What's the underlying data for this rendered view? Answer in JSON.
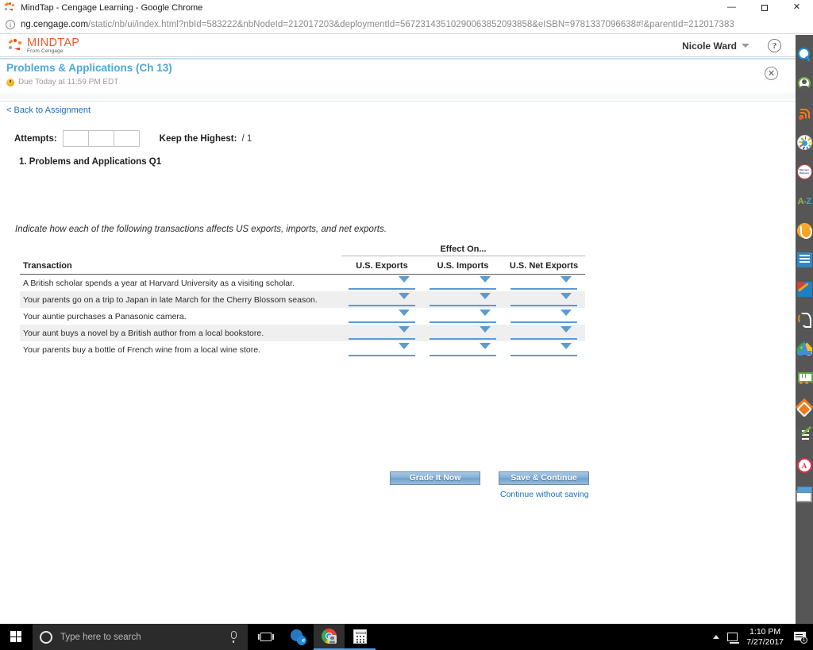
{
  "window": {
    "title": "MindTap - Cengage Learning - Google Chrome",
    "favicon": "mindtap-favicon",
    "controls": {
      "minimize": "—",
      "maximize": "❐",
      "close": "✕"
    }
  },
  "omnibox": {
    "info_icon": "i",
    "host": "ng.cengage.com",
    "path": "/static/nb/ui/index.html?nbId=583222&nbNodeId=212017203&deploymentId=56723143510290063852093858&eISBN=9781337096638#!&parentId=212017383"
  },
  "mindtap_header": {
    "logo_primary": "MINDTAP",
    "logo_secondary": "From Cengage",
    "user_name": "Nicole Ward",
    "help_label": "?"
  },
  "assignment": {
    "title": "Problems & Applications (Ch 13)",
    "due_text": "Due Today at 11:59 PM EDT",
    "close_label": "✕"
  },
  "content": {
    "back_link": "< Back to Assignment",
    "attempts_label": "Attempts:",
    "attempt_values": [
      "",
      "",
      ""
    ],
    "keep_highest_label": "Keep the Highest:",
    "keep_highest_value": "/ 1",
    "question_title": "1. Problems and Applications Q1",
    "prompt": "Indicate how each of the following transactions affects US exports, imports, and net exports."
  },
  "table": {
    "group_header": "Effect On...",
    "col_transaction": "Transaction",
    "columns": [
      "U.S. Exports",
      "U.S. Imports",
      "U.S. Net Exports"
    ],
    "rows": [
      {
        "transaction": "A British scholar spends a year at Harvard University as a visiting scholar.",
        "exports": "",
        "imports": "",
        "net_exports": ""
      },
      {
        "transaction": "Your parents go on a trip to Japan in late March for the Cherry Blossom season.",
        "exports": "",
        "imports": "",
        "net_exports": ""
      },
      {
        "transaction": "Your auntie purchases a Panasonic camera.",
        "exports": "",
        "imports": "",
        "net_exports": ""
      },
      {
        "transaction": "Your aunt buys a novel by a British author from a local bookstore.",
        "exports": "",
        "imports": "",
        "net_exports": ""
      },
      {
        "transaction": "Your parents buy a bottle of French wine from a local wine store.",
        "exports": "",
        "imports": "",
        "net_exports": ""
      }
    ]
  },
  "actions": {
    "grade_it_now": "Grade It Now",
    "save_and_continue": "Save & Continue",
    "continue_without_saving": "Continue without saving"
  },
  "tool_rail": {
    "items": [
      {
        "name": "search-icon",
        "label": "Search"
      },
      {
        "name": "profile-icon",
        "label": "Profile"
      },
      {
        "name": "rss-feed-icon",
        "label": "Feed"
      },
      {
        "name": "color-wheel-icon",
        "label": "Color Wheel"
      },
      {
        "name": "merriam-webster-icon",
        "label": "Merriam Webster"
      },
      {
        "name": "a-z-dictionary-icon",
        "label": "A-Z"
      },
      {
        "name": "six-swirl-icon",
        "label": "Cengage Tool"
      },
      {
        "name": "reader-book-icon",
        "label": "Reader"
      },
      {
        "name": "notebook-pencil-icon",
        "label": "Notes"
      },
      {
        "name": "read-aloud-icon",
        "label": "Read Aloud"
      },
      {
        "name": "google-drive-icon",
        "label": "Google Drive"
      },
      {
        "name": "shopping-cart-icon",
        "label": "Store"
      },
      {
        "name": "diamond-gear-icon",
        "label": "Tools"
      },
      {
        "name": "quiz-pencil-icon",
        "label": "Practice"
      },
      {
        "name": "a-plus-grade-icon",
        "label": "Grades"
      },
      {
        "name": "flashcards-icon",
        "label": "Flashcards"
      }
    ],
    "merriam_text": "Merriam Webster"
  },
  "taskbar": {
    "search_placeholder": "Type here to search",
    "apps": [
      {
        "name": "taskbar-app-edge",
        "label": "Microsoft Edge"
      },
      {
        "name": "taskbar-app-chrome",
        "label": "Google Chrome"
      },
      {
        "name": "taskbar-app-calculator",
        "label": "Calculator"
      }
    ],
    "time": "1:10 PM",
    "date": "7/27/2017",
    "notification_count": "1"
  },
  "colors": {
    "mindtap_orange": "#f05a28",
    "assignment_title_blue": "#4aa8dd",
    "link_blue": "#1d6fb8",
    "dropdown_blue": "#5b9bd1",
    "button_blue": "#7facd4",
    "rail_gray": "#565656",
    "row_alt_gray": "#efefef"
  }
}
